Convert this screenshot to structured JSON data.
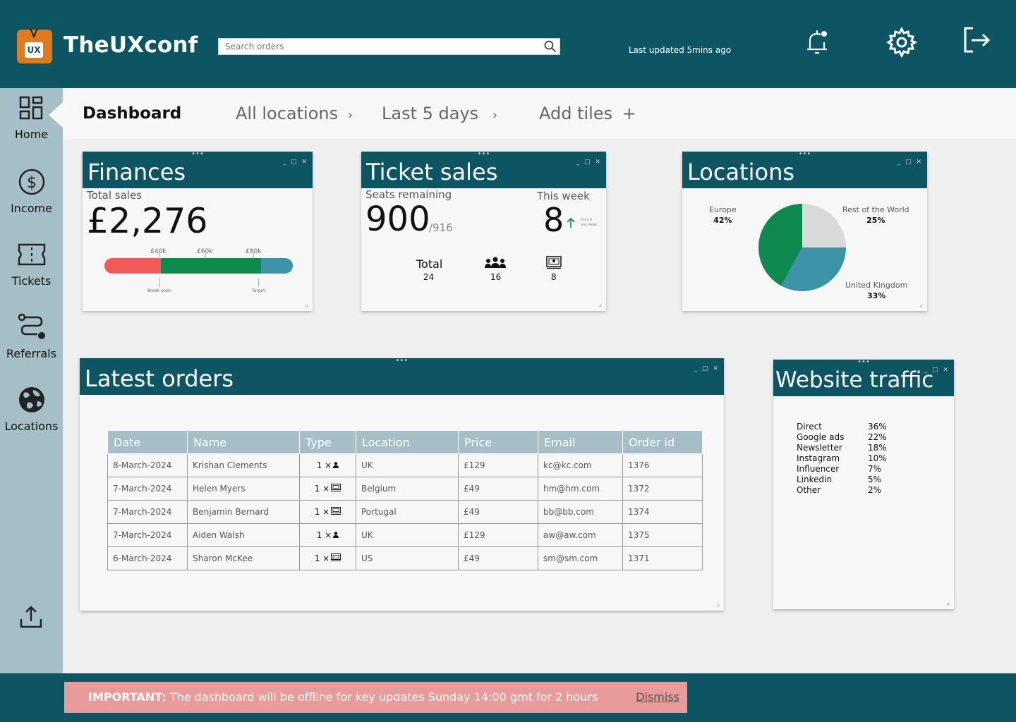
{
  "header": {
    "logo_text": "UX",
    "brand": "TheUXconf",
    "search_placeholder": "Search orders",
    "last_updated": "Last updated 5mins ago"
  },
  "sidebar": {
    "items": [
      {
        "label": "Home",
        "icon": "grid-icon"
      },
      {
        "label": "Income",
        "icon": "dollar-icon"
      },
      {
        "label": "Tickets",
        "icon": "ticket-icon"
      },
      {
        "label": "Referrals",
        "icon": "route-icon"
      },
      {
        "label": "Locations",
        "icon": "globe-icon"
      }
    ],
    "bottom_icon": "upload-icon"
  },
  "topbar": {
    "dashboard": "Dashboard",
    "locations": "All locations",
    "period": "Last 5 days",
    "add_tiles": "Add tiles"
  },
  "finances": {
    "title": "Finances",
    "label": "Total sales",
    "value": "£2,276",
    "ticks": [
      "£40k",
      "£60k",
      "£80k"
    ],
    "markers": [
      "Break even",
      "Target"
    ],
    "bar_segments": [
      {
        "color": "#f05a5a",
        "fraction": 0.3
      },
      {
        "color": "#0f8a4f",
        "fraction": 0.53
      },
      {
        "color": "#3d94a8",
        "fraction": 0.17
      }
    ]
  },
  "tickets": {
    "title": "Ticket sales",
    "seats_label": "Seats remaining",
    "seats_value": "900",
    "seats_total": "/916",
    "week_label": "This week",
    "week_value": "8",
    "week_note": "from 6 last week",
    "total_label": "Total",
    "total_value": "24",
    "in_person_value": "16",
    "online_value": "8"
  },
  "locations": {
    "title": "Locations",
    "slices": [
      {
        "name": "Europe",
        "pct": "42%",
        "value": 42,
        "color": "#0f8a4f"
      },
      {
        "name": "Rest of the World",
        "pct": "25%",
        "value": 25,
        "color": "#d9d9d9"
      },
      {
        "name": "United Kingdom",
        "pct": "33%",
        "value": 33,
        "color": "#3d94a8"
      }
    ]
  },
  "orders": {
    "title": "Latest orders",
    "columns": [
      "Date",
      "Name",
      "Type",
      "Location",
      "Price",
      "Email",
      "Order id"
    ],
    "rows": [
      {
        "date": "8-March-2024",
        "name": "Krishan Clements",
        "type": "1 ×",
        "kind": "person",
        "location": "UK",
        "price": "£129",
        "email": "kc@kc.com",
        "id": "1376"
      },
      {
        "date": "7-March-2024",
        "name": "Helen Myers",
        "type": "1 ×",
        "kind": "online",
        "location": "Belgium",
        "price": "£49",
        "email": "hm@hm.com",
        "id": "1372"
      },
      {
        "date": "7-March-2024",
        "name": "Benjamin Bernard",
        "type": "1 ×",
        "kind": "online",
        "location": "Portugal",
        "price": "£49",
        "email": "bb@bb.com",
        "id": "1374"
      },
      {
        "date": "7-March-2024",
        "name": "Aiden Walsh",
        "type": "1 ×",
        "kind": "person",
        "location": "UK",
        "price": "£129",
        "email": "aw@aw.com",
        "id": "1375"
      },
      {
        "date": "6-March-2024",
        "name": "Sharon McKee",
        "type": "1 ×",
        "kind": "online",
        "location": "US",
        "price": "£49",
        "email": "sm@sm.com",
        "id": "1371"
      }
    ]
  },
  "traffic": {
    "title": "Website traffic",
    "rows": [
      {
        "source": "Direct",
        "pct": "36%"
      },
      {
        "source": "Google ads",
        "pct": "22%"
      },
      {
        "source": "Newsletter",
        "pct": "18%"
      },
      {
        "source": "Instagram",
        "pct": "10%"
      },
      {
        "source": "Influencer",
        "pct": "7%"
      },
      {
        "source": "Linkedin",
        "pct": "5%"
      },
      {
        "source": "Other",
        "pct": "2%"
      }
    ]
  },
  "alert": {
    "important": "IMPORTANT:",
    "message": " The dashboard will be offline for key updates Sunday 14:00 gmt for 2 hours",
    "dismiss": "Dismiss"
  },
  "colors": {
    "primary": "#0d5563",
    "sidebar": "#a6bfc6",
    "green": "#0f8a4f",
    "red": "#f05a5a",
    "teal": "#3d94a8",
    "alert": "#e99a9a"
  }
}
